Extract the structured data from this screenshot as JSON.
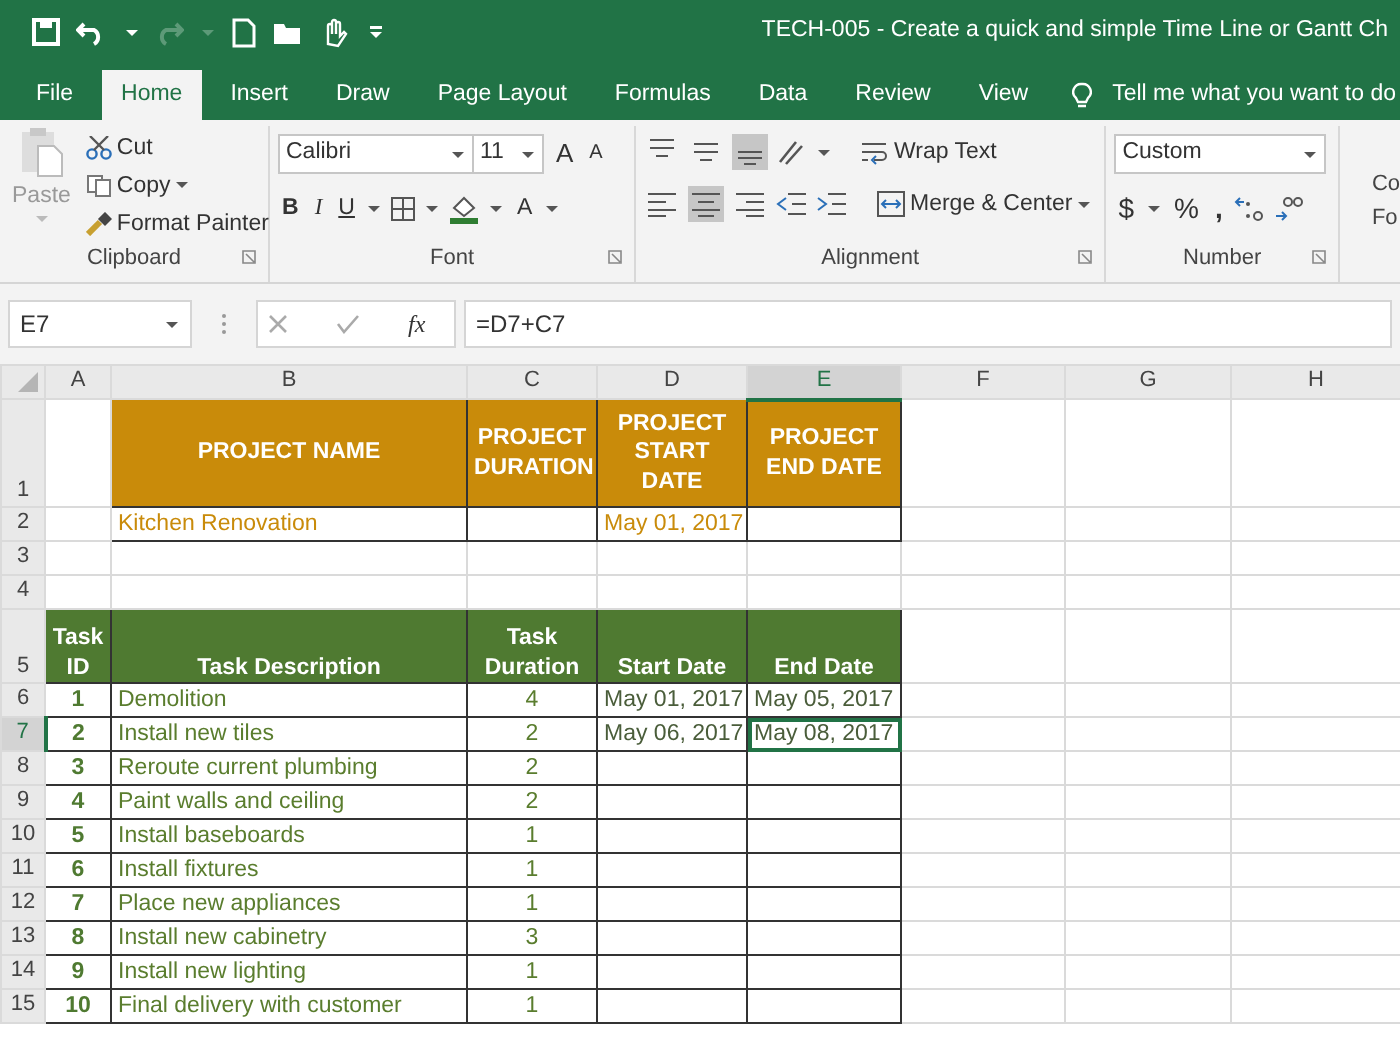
{
  "title_bar": {
    "title": "TECH-005 - Create a quick and simple Time Line or Gantt Ch"
  },
  "tabs": [
    {
      "label": "File",
      "selected": false
    },
    {
      "label": "Home",
      "selected": true
    },
    {
      "label": "Insert",
      "selected": false
    },
    {
      "label": "Draw",
      "selected": false
    },
    {
      "label": "Page Layout",
      "selected": false
    },
    {
      "label": "Formulas",
      "selected": false
    },
    {
      "label": "Data",
      "selected": false
    },
    {
      "label": "Review",
      "selected": false
    },
    {
      "label": "View",
      "selected": false
    }
  ],
  "tell_me": "Tell me what you want to do",
  "ribbon": {
    "clipboard": {
      "paste": "Paste",
      "cut": "Cut",
      "copy": "Copy",
      "format_painter": "Format Painter",
      "label": "Clipboard"
    },
    "font": {
      "font_name": "Calibri",
      "font_size": "11",
      "grow": "A",
      "shrink": "A",
      "bold": "B",
      "italic": "I",
      "underline": "U",
      "font_color": "A",
      "label": "Font"
    },
    "alignment": {
      "vertical": [
        {
          "selected": false
        },
        {
          "selected": false
        },
        {
          "selected": true
        }
      ],
      "horizontal": [
        {
          "selected": false
        },
        {
          "selected": true
        },
        {
          "selected": false
        }
      ],
      "wrap_text": "Wrap Text",
      "merge_center": "Merge & Center",
      "label": "Alignment"
    },
    "number": {
      "format": "Custom",
      "currency": "$",
      "percent": "%",
      "comma": ",",
      "label": "Number"
    },
    "cut_off": [
      "Co",
      "Fo"
    ]
  },
  "formula_bar": {
    "name_box": "E7",
    "fx": "fx",
    "formula": "=D7+C7"
  },
  "sheet": {
    "columns": [
      {
        "label": "A",
        "selected": false
      },
      {
        "label": "B",
        "selected": false
      },
      {
        "label": "C",
        "selected": false
      },
      {
        "label": "D",
        "selected": false
      },
      {
        "label": "E",
        "selected": true
      },
      {
        "label": "F",
        "selected": false
      },
      {
        "label": "G",
        "selected": false
      },
      {
        "label": "H",
        "selected": false
      }
    ],
    "rows": [
      {
        "number": "1",
        "kind": "project_header",
        "selected": false,
        "cells": {
          "B": "PROJECT NAME",
          "C": "PROJECT DURATION",
          "D": "PROJECT START DATE",
          "E": "PROJECT END DATE"
        }
      },
      {
        "number": "2",
        "kind": "project_data",
        "selected": false,
        "cells": {
          "B": "Kitchen Renovation",
          "D": "May 01, 2017"
        }
      },
      {
        "number": "3",
        "kind": "blank",
        "selected": false,
        "cells": {}
      },
      {
        "number": "4",
        "kind": "blank",
        "selected": false,
        "cells": {}
      },
      {
        "number": "5",
        "kind": "task_header",
        "selected": false,
        "cells": {
          "A": "Task ID",
          "B": "Task Description",
          "C": "Task Duration",
          "D": "Start Date",
          "E": "End Date"
        }
      },
      {
        "number": "6",
        "kind": "task",
        "selected": false,
        "cells": {
          "A": "1",
          "B": "Demolition",
          "C": "4",
          "D": "May 01, 2017",
          "E": "May 05, 2017"
        }
      },
      {
        "number": "7",
        "kind": "task",
        "selected": true,
        "cells": {
          "A": "2",
          "B": "Install new tiles",
          "C": "2",
          "D": "May 06, 2017",
          "E": "May 08, 2017"
        }
      },
      {
        "number": "8",
        "kind": "task",
        "selected": false,
        "cells": {
          "A": "3",
          "B": "Reroute current plumbing",
          "C": "2"
        }
      },
      {
        "number": "9",
        "kind": "task",
        "selected": false,
        "cells": {
          "A": "4",
          "B": "Paint walls and ceiling",
          "C": "2"
        }
      },
      {
        "number": "10",
        "kind": "task",
        "selected": false,
        "cells": {
          "A": "5",
          "B": "Install baseboards",
          "C": "1"
        }
      },
      {
        "number": "11",
        "kind": "task",
        "selected": false,
        "cells": {
          "A": "6",
          "B": "Install fixtures",
          "C": "1"
        }
      },
      {
        "number": "12",
        "kind": "task",
        "selected": false,
        "cells": {
          "A": "7",
          "B": "Place new appliances",
          "C": "1"
        }
      },
      {
        "number": "13",
        "kind": "task",
        "selected": false,
        "cells": {
          "A": "8",
          "B": "Install new cabinetry",
          "C": "3"
        }
      },
      {
        "number": "14",
        "kind": "task",
        "selected": false,
        "cells": {
          "A": "9",
          "B": "Install new lighting",
          "C": "1"
        }
      },
      {
        "number": "15",
        "kind": "task",
        "selected": false,
        "cells": {
          "A": "10",
          "B": "Final delivery with customer",
          "C": "1"
        }
      }
    ]
  }
}
